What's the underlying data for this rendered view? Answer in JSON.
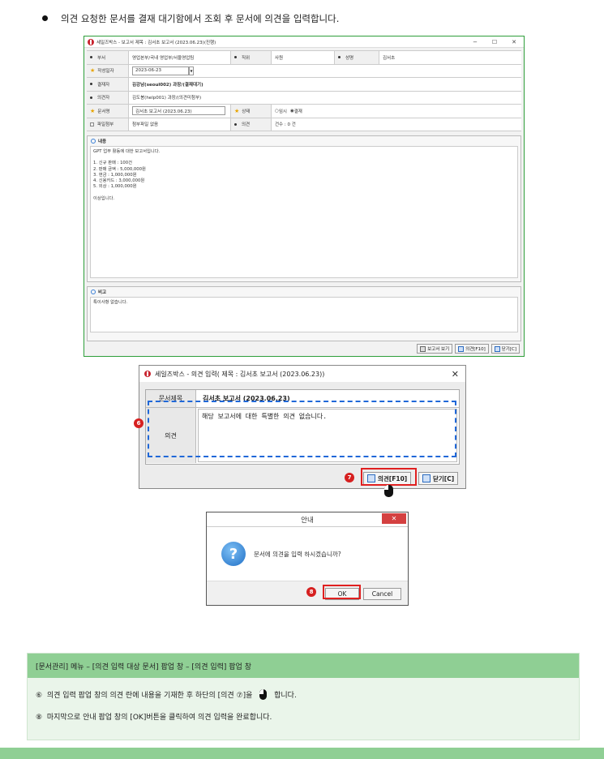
{
  "heading": "의견 요청한 문서를 결재 대기함에서 조회 후 문서에 의견을 입력합니다.",
  "win1": {
    "title": "세일즈박스 - 보고서 제목 : 김서초 보고서 (2023.06.23)(진행)",
    "controls": [
      "−",
      "☐",
      "✕"
    ],
    "rows": [
      [
        "부서",
        "영업본부/국내 영업부/서울영업팀",
        "직위",
        "사원",
        "성명",
        "김서초"
      ],
      [
        "작성일자",
        "2023-06-23"
      ],
      [
        "결재자",
        "김강남(seoul002) 과장/(결재대기)"
      ],
      [
        "의견자",
        "김도봉(help001) 과장/(의견미첨부)"
      ],
      [
        "문서명",
        "김서초 보고서 (2023.06.23)",
        "상태",
        "임시",
        "결재"
      ],
      [
        "파일첨부",
        "첨부파일 없음",
        "의견",
        "건수 : 0 건"
      ]
    ],
    "content_label": "내용",
    "content_text": "GPT 업무 활동에 대한 보고서입니다.\n\n1. 신규 판매 : 100건\n2. 판매 금액 : 5,000,000원\n3. 현금 : 1,000,000원\n4. 신용카드 : 3,000,000원\n5. 외상 : 1,000,000원\n\n이상입니다.",
    "remark_label": "비고",
    "remark_text": "특이사항 없습니다.",
    "btn_report": "보고서 보기",
    "btn_opinion": "의견[F10]",
    "btn_close": "닫기[C]"
  },
  "win2": {
    "title": "세일즈박스 - 의견 입력( 제목 : 김서초 보고서 (2023.06.23))",
    "close": "✕",
    "doc_label": "문서제목",
    "doc_value": "김서초 보고서 (2023.06.23)",
    "opinion_label": "의견",
    "opinion_text": "해당 보고서에 대한 특별한 의견 없습니다.",
    "btn_opinion": "의견[F10]",
    "btn_close": "닫기[C]",
    "badge6": "6",
    "badge7": "7"
  },
  "dlg": {
    "title": "안내",
    "close": "✕",
    "message": "문서에 의견을 입력 하시겠습니까?",
    "ok": "OK",
    "cancel": "Cancel",
    "badge8": "8"
  },
  "notes": {
    "header": "[문서관리] 메뉴 – [의견 입력 대상 문서] 팝업 창 – [의견 입력] 팝업 창",
    "n6_num": "⑥",
    "n6_text": "의견 입력 팝업 창의 의견 란에 내용을 기재한 후 하단의 [의견  ⑦]을",
    "n6_tail": "합니다.",
    "n8_num": "⑧",
    "n8_text": "마지막으로 안내 팝업 창의 [OK]버튼을 클릭하여 의견 입력을 완료합니다."
  }
}
